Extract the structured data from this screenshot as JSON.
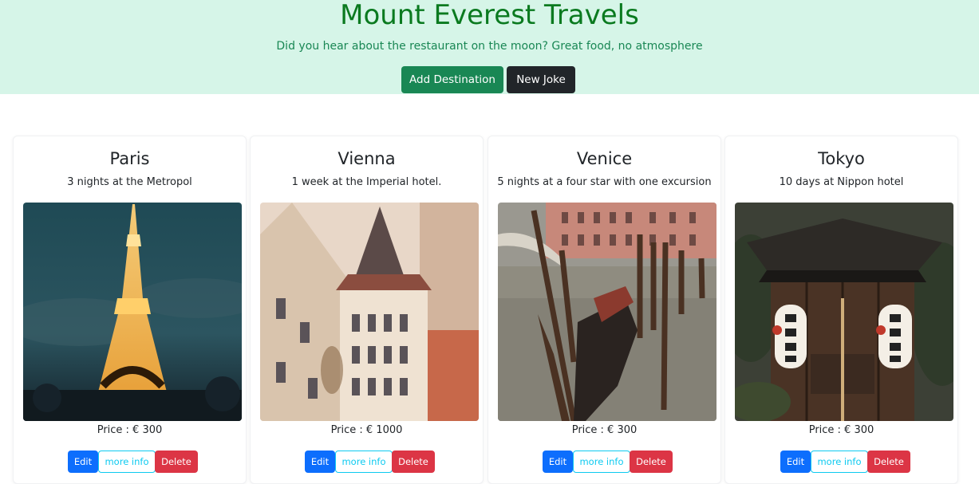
{
  "header": {
    "title": "Mount Everest Travels",
    "joke": "Did you hear about the restaurant on the moon? Great food, no atmosphere",
    "add_button": "Add Destination",
    "joke_button": "New Joke",
    "background": "#d6f5e8",
    "title_color": "#0a7a1f"
  },
  "cards": [
    {
      "city": "Paris",
      "description": "3 nights at the Metropol",
      "image_icon": "eiffel-tower-photo",
      "price": "Price : € 300",
      "edit": "Edit",
      "info": "more info",
      "delete": "Delete"
    },
    {
      "city": "Vienna",
      "description": "1 week at the Imperial hotel.",
      "image_icon": "vienna-building-photo",
      "price": "Price : € 1000",
      "edit": "Edit",
      "info": "more info",
      "delete": "Delete"
    },
    {
      "city": "Venice",
      "description": "5 nights at a four star with one excursion",
      "image_icon": "venice-gondola-photo",
      "price": "Price : € 300",
      "edit": "Edit",
      "info": "more info",
      "delete": "Delete"
    },
    {
      "city": "Tokyo",
      "description": "10 days at Nippon hotel",
      "image_icon": "tokyo-shrine-photo",
      "price": "Price : € 300",
      "edit": "Edit",
      "info": "more info",
      "delete": "Delete"
    }
  ],
  "colors": {
    "success": "#198754",
    "dark": "#212529",
    "primary": "#0d6efd",
    "info": "#0dcaf0",
    "danger": "#dc3545"
  }
}
